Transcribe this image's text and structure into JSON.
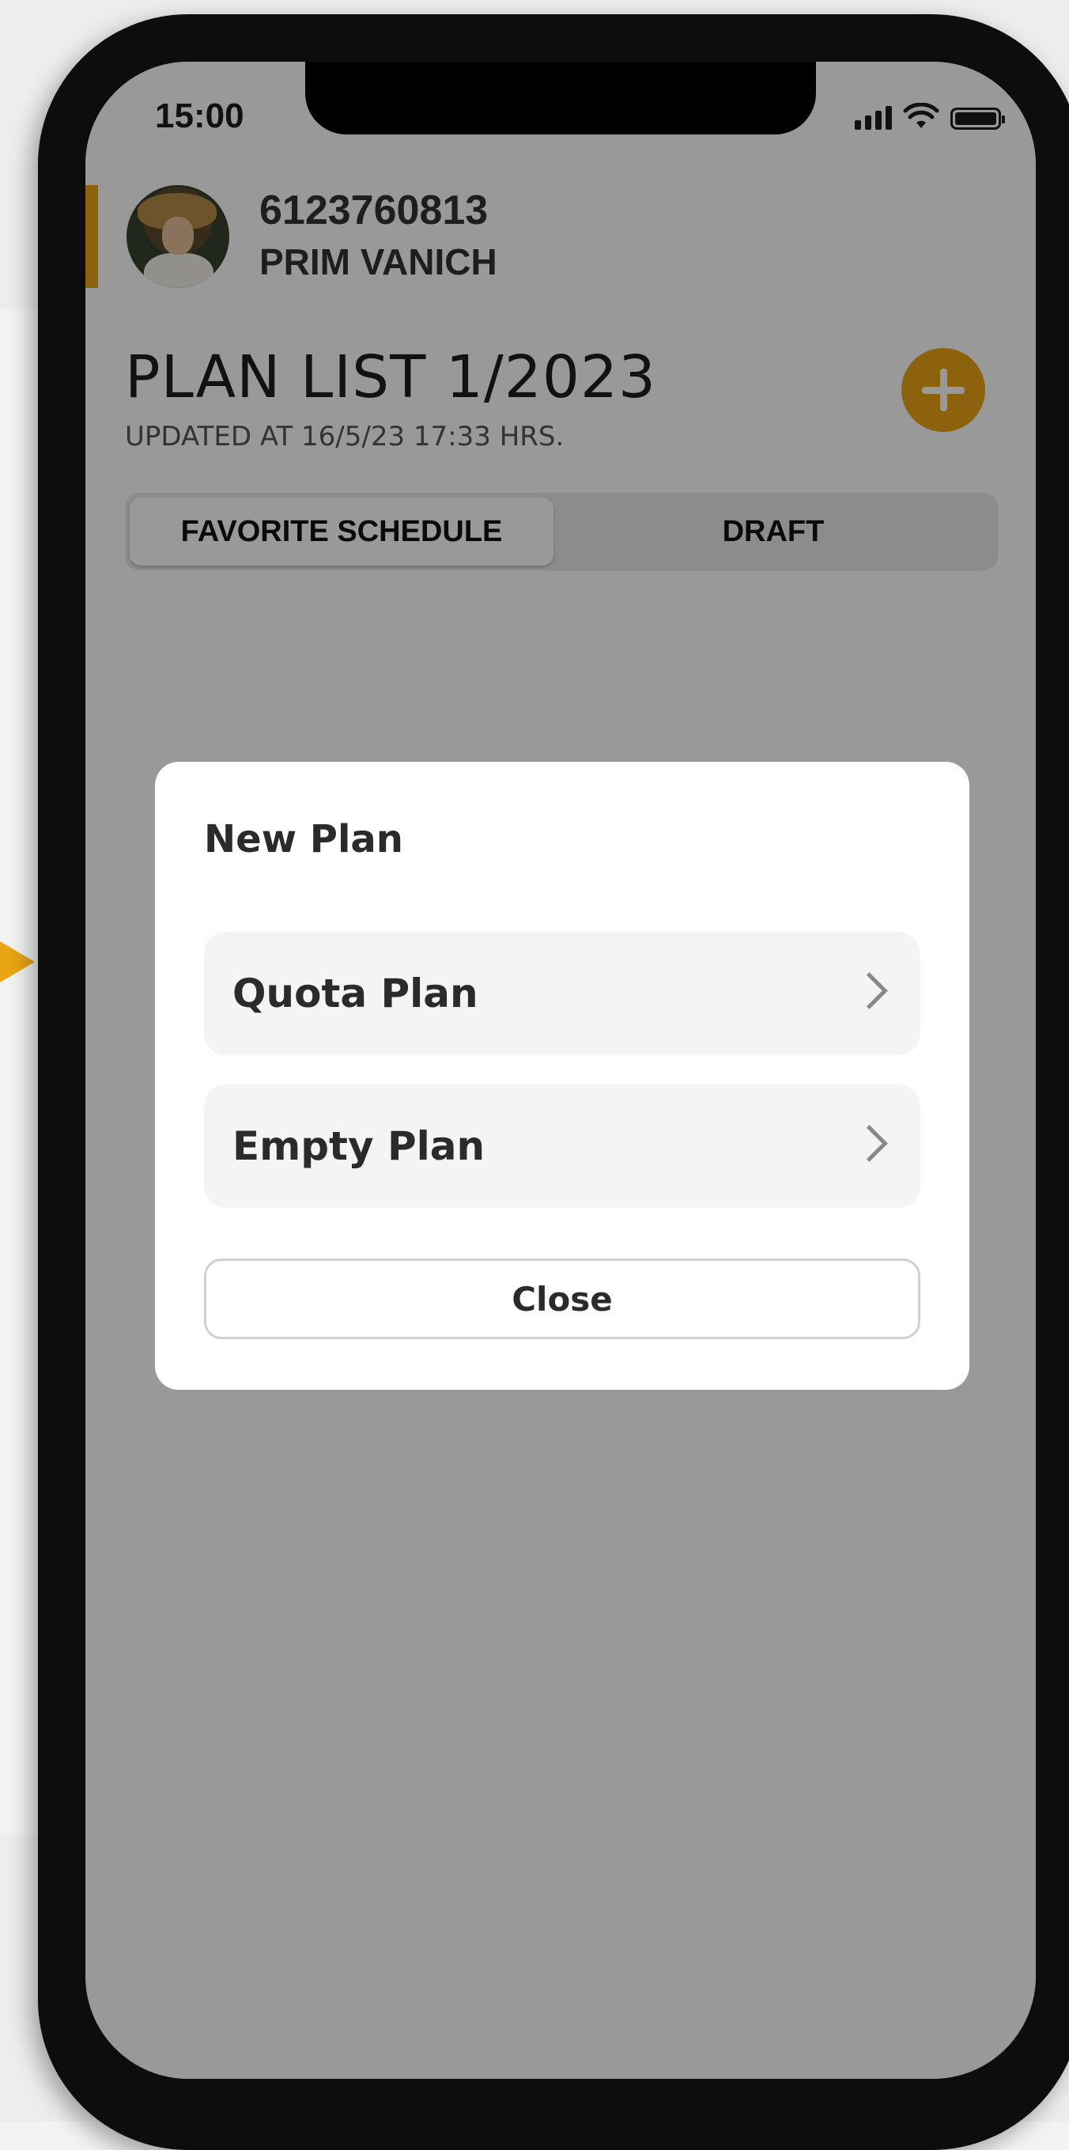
{
  "status_bar": {
    "time": "15:00"
  },
  "user": {
    "id": "6123760813",
    "name": "PRIM VANICH"
  },
  "page": {
    "title": "PLAN LIST 1/2023",
    "updated": "UPDATED AT 16/5/23 17:33 HRS."
  },
  "tabs": [
    {
      "label": "FAVORITE SCHEDULE",
      "active": true
    },
    {
      "label": "DRAFT",
      "active": false
    }
  ],
  "modal": {
    "title": "New Plan",
    "options": [
      {
        "label": "Quota Plan"
      },
      {
        "label": "Empty Plan"
      }
    ],
    "close_label": "Close"
  },
  "colors": {
    "accent": "#e9a514",
    "overlay": "rgba(0,0,0,0.4)"
  },
  "icons": {
    "add": "plus-icon",
    "chevron": "chevron-right-icon",
    "signal": "signal-icon",
    "wifi": "wifi-icon",
    "battery": "battery-icon"
  }
}
